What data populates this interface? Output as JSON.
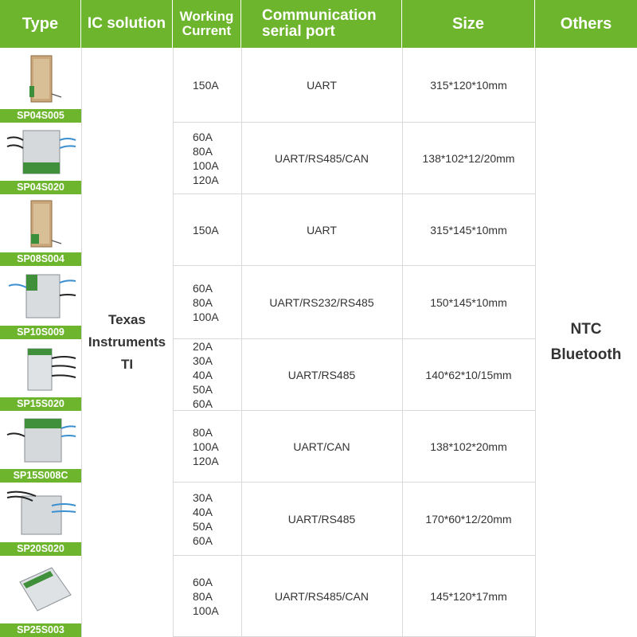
{
  "header": {
    "type": "Type",
    "ic": "IC solution",
    "current": "Working\nCurrent",
    "comm": "Communication\nserial port",
    "size": "Size",
    "others": "Others"
  },
  "ic_solution": {
    "line1": "Texas",
    "line2": "Instruments",
    "line3": "TI"
  },
  "others": {
    "line1": "NTC",
    "line2": "Bluetooth"
  },
  "rows": [
    {
      "model": "SP04S005",
      "current": "150A",
      "comm": "UART",
      "size": "315*120*10mm"
    },
    {
      "model": "SP04S020",
      "current": "60A\n80A\n100A\n120A",
      "comm": "UART/RS485/CAN",
      "size": "138*102*12/20mm"
    },
    {
      "model": "SP08S004",
      "current": "150A",
      "comm": "UART",
      "size": "315*145*10mm"
    },
    {
      "model": "SP10S009",
      "current": "60A\n80A\n100A",
      "comm": "UART/RS232/RS485",
      "size": "150*145*10mm"
    },
    {
      "model": "SP15S020",
      "current": "20A\n30A\n40A\n50A\n60A",
      "comm": "UART/RS485",
      "size": "140*62*10/15mm"
    },
    {
      "model": "SP15S008C",
      "current": "80A\n100A\n120A",
      "comm": "UART/CAN",
      "size": "138*102*20mm"
    },
    {
      "model": "SP20S020",
      "current": "30A\n40A\n50A\n60A",
      "comm": "UART/RS485",
      "size": "170*60*12/20mm"
    },
    {
      "model": "SP25S003",
      "current": "60A\n80A\n100A",
      "comm": "UART/RS485/CAN",
      "size": "145*120*17mm"
    }
  ],
  "colors": {
    "header_green": "#6db52d",
    "text": "#333333",
    "grid": "#d9d9d9"
  }
}
